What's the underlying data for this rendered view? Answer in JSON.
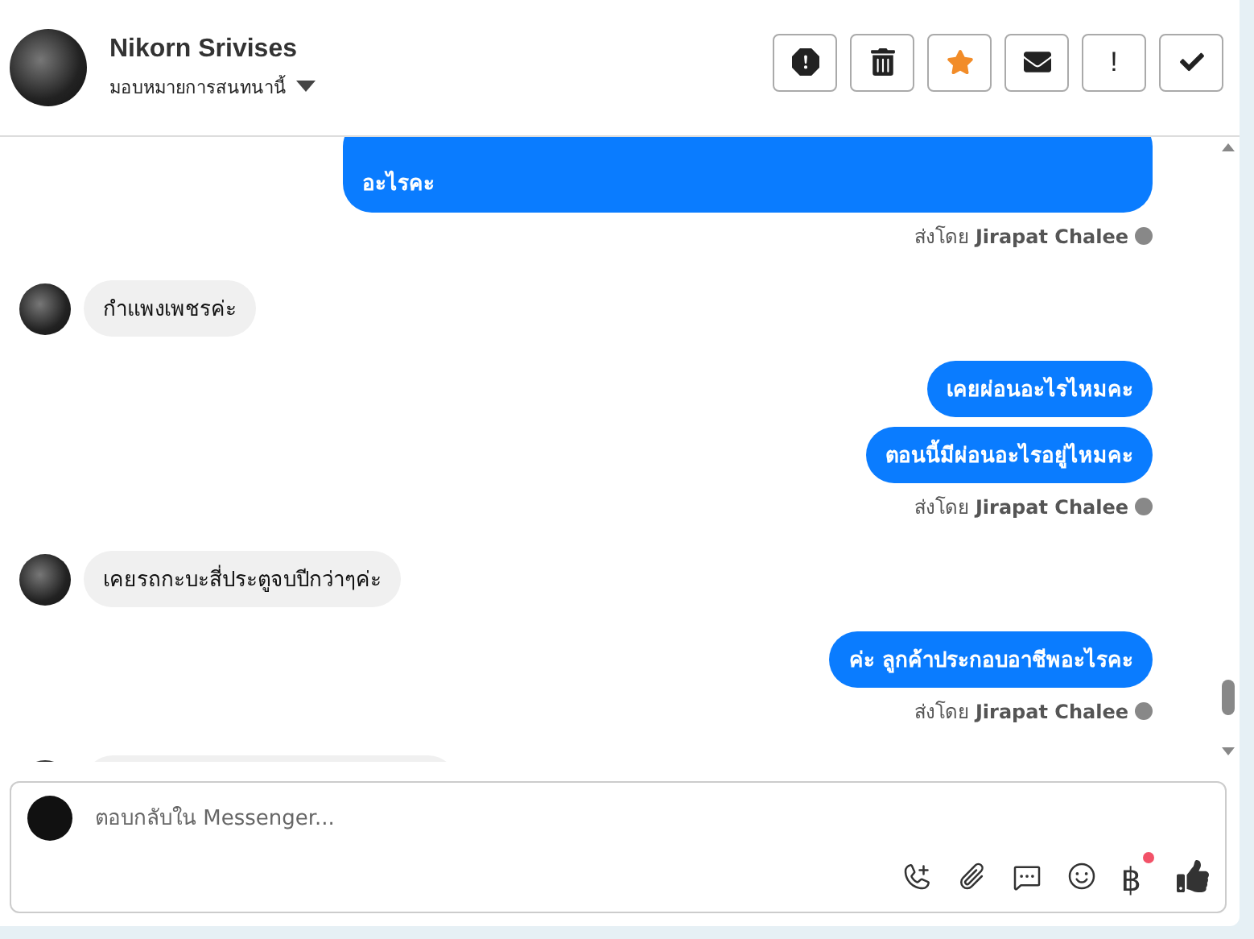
{
  "header": {
    "name": "Nikorn Srivises",
    "assign_label": "มอบหมายการสนทนานี้",
    "actions": [
      {
        "kind": "alert"
      },
      {
        "kind": "trash"
      },
      {
        "kind": "star"
      },
      {
        "kind": "mail"
      },
      {
        "kind": "mark",
        "label": "!"
      },
      {
        "kind": "check"
      }
    ]
  },
  "messages": [
    {
      "kind": "outgoing",
      "text": "อะไรคะ",
      "clipped": true
    },
    {
      "kind": "note",
      "prefix": "ส่งโดย",
      "sender": "Jirapat Chalee"
    },
    {
      "kind": "incoming",
      "text": "กำแพงเพชรค่ะ"
    },
    {
      "kind": "outgoing",
      "text": "เคยผ่อนอะไรไหมคะ"
    },
    {
      "kind": "outgoing",
      "text": "ตอนนี้มีผ่อนอะไรอยู่ไหมคะ"
    },
    {
      "kind": "note",
      "prefix": "ส่งโดย",
      "sender": "Jirapat Chalee"
    },
    {
      "kind": "incoming",
      "text": "เคยรถกะบะสี่ประตูจบปีกว่าๆค่ะ"
    },
    {
      "kind": "outgoing",
      "text": "ค่ะ ลูกค้าประกอบอาชีพอะไรคะ"
    },
    {
      "kind": "note",
      "prefix": "ส่งโดย",
      "sender": "Jirapat Chalee"
    },
    {
      "kind": "incoming",
      "clipped": true
    }
  ],
  "composer": {
    "placeholder": "ตอบกลับใน Messenger...",
    "tools": [
      {
        "kind": "call",
        "badge": false
      },
      {
        "kind": "attach",
        "badge": false
      },
      {
        "kind": "chat",
        "badge": false
      },
      {
        "kind": "emoji",
        "badge": false
      },
      {
        "kind": "baht",
        "label": "฿",
        "badge": true
      },
      {
        "kind": "like",
        "badge": false
      }
    ]
  }
}
